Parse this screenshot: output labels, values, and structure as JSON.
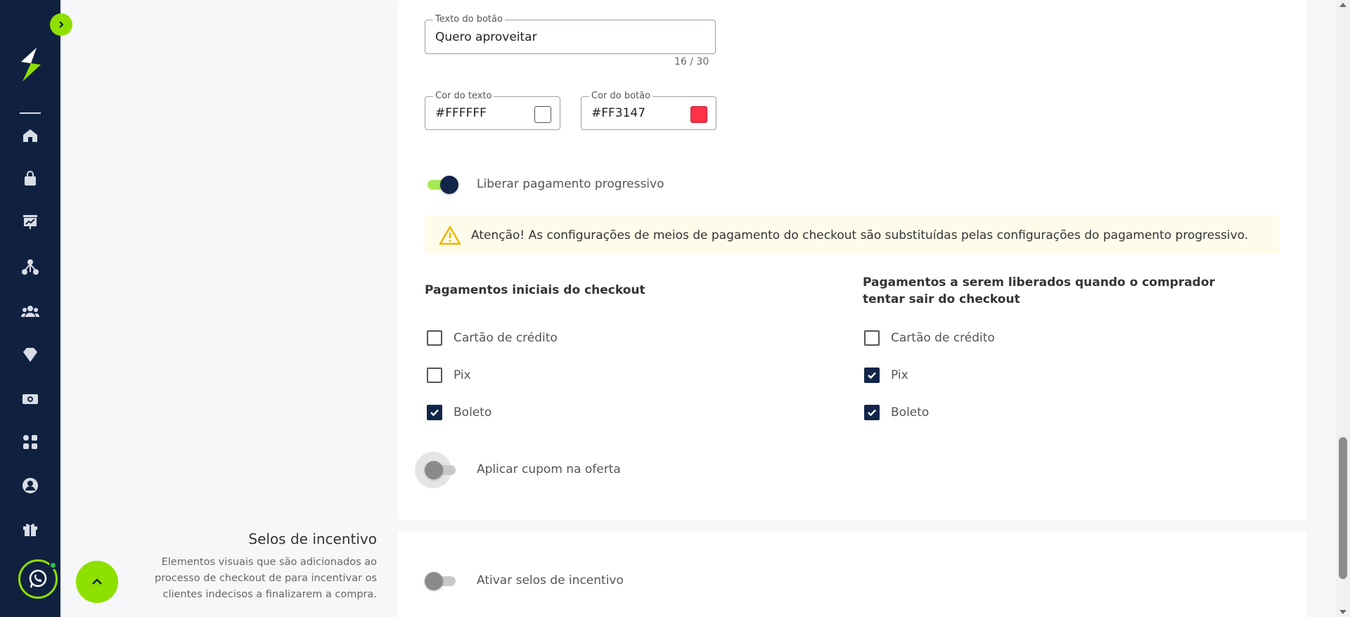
{
  "colors": {
    "sidebar_bg": "#102140",
    "accent_green": "#8ee000",
    "navy": "#12254a",
    "text_color_white": "#FFFFFF",
    "button_color_red": "#FF3147"
  },
  "button_text_field": {
    "legend": "Texto do botão",
    "value": "Quero aproveitar",
    "counter": "16 / 30"
  },
  "text_color_field": {
    "legend": "Cor do texto",
    "value": "#FFFFFF"
  },
  "button_color_field": {
    "legend": "Cor do botão",
    "value": "#FF3147"
  },
  "progressive_payment": {
    "label": "Liberar pagamento progressivo",
    "enabled": true
  },
  "alert": {
    "icon": "warning-icon",
    "text": "Atenção! As configurações de meios de pagamento do checkout são substituídas pelas configurações do pagamento progressivo."
  },
  "initial_payments": {
    "heading": "Pagamentos iniciais do checkout",
    "options": [
      {
        "label": "Cartão de crédito",
        "checked": false
      },
      {
        "label": "Pix",
        "checked": false
      },
      {
        "label": "Boleto",
        "checked": true
      }
    ]
  },
  "released_payments": {
    "heading": "Pagamentos a serem liberados quando o comprador tentar sair do checkout",
    "options": [
      {
        "label": "Cartão de crédito",
        "checked": false
      },
      {
        "label": "Pix",
        "checked": true
      },
      {
        "label": "Boleto",
        "checked": true
      }
    ]
  },
  "coupon": {
    "label": "Aplicar cupom na oferta",
    "enabled": false
  },
  "incentive_seals": {
    "title": "Selos de incentivo",
    "description": "Elementos visuais que são adicionados ao processo de checkout de para incentivar os clientes indecisos a finalizarem a compra.",
    "toggle_label": "Ativar selos de incentivo",
    "enabled": false
  },
  "sidebar": {
    "icons": [
      "home-icon",
      "shopping-bag-icon",
      "presentation-chart-icon",
      "affiliates-network-icon",
      "users-group-icon",
      "diamond-icon",
      "money-icon",
      "apps-grid-icon",
      "user-account-icon",
      "gift-icon"
    ]
  }
}
